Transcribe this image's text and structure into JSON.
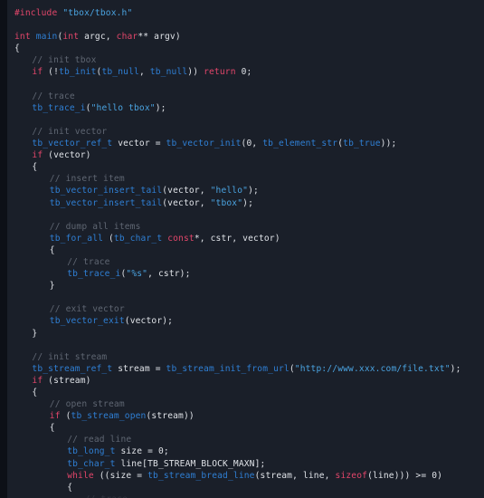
{
  "editor": {
    "language": "c",
    "theme_name": "dark",
    "background_color": "#1a1f29",
    "gutter_color": "#0d1017",
    "colors": {
      "keyword": "#e2466a",
      "preprocessor": "#e2466a",
      "function": "#2f7fd4",
      "type": "#2f7fd4",
      "string": "#4aa3e0",
      "comment": "#5f6672",
      "number": "#dfe2e7",
      "plain": "#dfe2e7"
    },
    "font_size_px": 9.6,
    "line_height_px": 13.1,
    "indent_spaces": 4
  },
  "code": {
    "header_include": "#include \"tbox/tbox.h\"",
    "header_include_directive": "#include",
    "header_include_path": "\"tbox/tbox.h\"",
    "lines": [
      {
        "indent": 0,
        "tokens": [
          {
            "c": "t-pre",
            "t": "#include"
          },
          {
            "c": "t-plain",
            "t": " "
          },
          {
            "c": "t-str",
            "t": "\"tbox/tbox.h\""
          }
        ]
      },
      {
        "indent": 0,
        "tokens": []
      },
      {
        "indent": 0,
        "tokens": [
          {
            "c": "t-kw",
            "t": "int"
          },
          {
            "c": "t-plain",
            "t": " "
          },
          {
            "c": "t-fn",
            "t": "main"
          },
          {
            "c": "t-plain",
            "t": "("
          },
          {
            "c": "t-kw",
            "t": "int"
          },
          {
            "c": "t-plain",
            "t": " argc, "
          },
          {
            "c": "t-kw",
            "t": "char"
          },
          {
            "c": "t-plain",
            "t": "** argv)"
          }
        ]
      },
      {
        "indent": 0,
        "tokens": [
          {
            "c": "t-plain",
            "t": "{"
          }
        ]
      },
      {
        "indent": 1,
        "tokens": [
          {
            "c": "t-cmt",
            "t": "// init tbox"
          }
        ]
      },
      {
        "indent": 1,
        "tokens": [
          {
            "c": "t-kw",
            "t": "if"
          },
          {
            "c": "t-plain",
            "t": " (!"
          },
          {
            "c": "t-fn",
            "t": "tb_init"
          },
          {
            "c": "t-plain",
            "t": "("
          },
          {
            "c": "t-fn",
            "t": "tb_null"
          },
          {
            "c": "t-plain",
            "t": ", "
          },
          {
            "c": "t-fn",
            "t": "tb_null"
          },
          {
            "c": "t-plain",
            "t": ")) "
          },
          {
            "c": "t-kw",
            "t": "return"
          },
          {
            "c": "t-plain",
            "t": " "
          },
          {
            "c": "t-num",
            "t": "0"
          },
          {
            "c": "t-plain",
            "t": ";"
          }
        ]
      },
      {
        "indent": 0,
        "tokens": []
      },
      {
        "indent": 1,
        "tokens": [
          {
            "c": "t-cmt",
            "t": "// trace"
          }
        ]
      },
      {
        "indent": 1,
        "tokens": [
          {
            "c": "t-fn",
            "t": "tb_trace_i"
          },
          {
            "c": "t-plain",
            "t": "("
          },
          {
            "c": "t-str",
            "t": "\"hello tbox\""
          },
          {
            "c": "t-plain",
            "t": ");"
          }
        ]
      },
      {
        "indent": 0,
        "tokens": []
      },
      {
        "indent": 1,
        "tokens": [
          {
            "c": "t-cmt",
            "t": "// init vector"
          }
        ]
      },
      {
        "indent": 1,
        "tokens": [
          {
            "c": "t-type",
            "t": "tb_vector_ref_t"
          },
          {
            "c": "t-plain",
            "t": " vector = "
          },
          {
            "c": "t-fn",
            "t": "tb_vector_init"
          },
          {
            "c": "t-plain",
            "t": "("
          },
          {
            "c": "t-num",
            "t": "0"
          },
          {
            "c": "t-plain",
            "t": ", "
          },
          {
            "c": "t-fn",
            "t": "tb_element_str"
          },
          {
            "c": "t-plain",
            "t": "("
          },
          {
            "c": "t-fn",
            "t": "tb_true"
          },
          {
            "c": "t-plain",
            "t": "));"
          }
        ]
      },
      {
        "indent": 1,
        "tokens": [
          {
            "c": "t-kw",
            "t": "if"
          },
          {
            "c": "t-plain",
            "t": " (vector)"
          }
        ]
      },
      {
        "indent": 1,
        "tokens": [
          {
            "c": "t-plain",
            "t": "{"
          }
        ]
      },
      {
        "indent": 2,
        "tokens": [
          {
            "c": "t-cmt",
            "t": "// insert item"
          }
        ]
      },
      {
        "indent": 2,
        "tokens": [
          {
            "c": "t-fn",
            "t": "tb_vector_insert_tail"
          },
          {
            "c": "t-plain",
            "t": "(vector, "
          },
          {
            "c": "t-str",
            "t": "\"hello\""
          },
          {
            "c": "t-plain",
            "t": ");"
          }
        ]
      },
      {
        "indent": 2,
        "tokens": [
          {
            "c": "t-fn",
            "t": "tb_vector_insert_tail"
          },
          {
            "c": "t-plain",
            "t": "(vector, "
          },
          {
            "c": "t-str",
            "t": "\"tbox\""
          },
          {
            "c": "t-plain",
            "t": ");"
          }
        ]
      },
      {
        "indent": 0,
        "tokens": []
      },
      {
        "indent": 2,
        "tokens": [
          {
            "c": "t-cmt",
            "t": "// dump all items"
          }
        ]
      },
      {
        "indent": 2,
        "tokens": [
          {
            "c": "t-fn",
            "t": "tb_for_all"
          },
          {
            "c": "t-plain",
            "t": " ("
          },
          {
            "c": "t-type",
            "t": "tb_char_t"
          },
          {
            "c": "t-plain",
            "t": " "
          },
          {
            "c": "t-kw",
            "t": "const"
          },
          {
            "c": "t-plain",
            "t": "*, cstr, vector)"
          }
        ]
      },
      {
        "indent": 2,
        "tokens": [
          {
            "c": "t-plain",
            "t": "{"
          }
        ]
      },
      {
        "indent": 3,
        "tokens": [
          {
            "c": "t-cmt",
            "t": "// trace"
          }
        ]
      },
      {
        "indent": 3,
        "tokens": [
          {
            "c": "t-fn",
            "t": "tb_trace_i"
          },
          {
            "c": "t-plain",
            "t": "("
          },
          {
            "c": "t-str",
            "t": "\"%s\""
          },
          {
            "c": "t-plain",
            "t": ", cstr);"
          }
        ]
      },
      {
        "indent": 2,
        "tokens": [
          {
            "c": "t-plain",
            "t": "}"
          }
        ]
      },
      {
        "indent": 0,
        "tokens": []
      },
      {
        "indent": 2,
        "tokens": [
          {
            "c": "t-cmt",
            "t": "// exit vector"
          }
        ]
      },
      {
        "indent": 2,
        "tokens": [
          {
            "c": "t-fn",
            "t": "tb_vector_exit"
          },
          {
            "c": "t-plain",
            "t": "(vector);"
          }
        ]
      },
      {
        "indent": 1,
        "tokens": [
          {
            "c": "t-plain",
            "t": "}"
          }
        ]
      },
      {
        "indent": 0,
        "tokens": []
      },
      {
        "indent": 1,
        "tokens": [
          {
            "c": "t-cmt",
            "t": "// init stream"
          }
        ]
      },
      {
        "indent": 1,
        "tokens": [
          {
            "c": "t-type",
            "t": "tb_stream_ref_t"
          },
          {
            "c": "t-plain",
            "t": " stream = "
          },
          {
            "c": "t-fn",
            "t": "tb_stream_init_from_url"
          },
          {
            "c": "t-plain",
            "t": "("
          },
          {
            "c": "t-str",
            "t": "\"http://www.xxx.com/file.txt\""
          },
          {
            "c": "t-plain",
            "t": ");"
          }
        ]
      },
      {
        "indent": 1,
        "tokens": [
          {
            "c": "t-kw",
            "t": "if"
          },
          {
            "c": "t-plain",
            "t": " (stream)"
          }
        ]
      },
      {
        "indent": 1,
        "tokens": [
          {
            "c": "t-plain",
            "t": "{"
          }
        ]
      },
      {
        "indent": 2,
        "tokens": [
          {
            "c": "t-cmt",
            "t": "// open stream"
          }
        ]
      },
      {
        "indent": 2,
        "tokens": [
          {
            "c": "t-kw",
            "t": "if"
          },
          {
            "c": "t-plain",
            "t": " ("
          },
          {
            "c": "t-fn",
            "t": "tb_stream_open"
          },
          {
            "c": "t-plain",
            "t": "(stream))"
          }
        ]
      },
      {
        "indent": 2,
        "tokens": [
          {
            "c": "t-plain",
            "t": "{"
          }
        ]
      },
      {
        "indent": 3,
        "tokens": [
          {
            "c": "t-cmt",
            "t": "// read line"
          }
        ]
      },
      {
        "indent": 3,
        "tokens": [
          {
            "c": "t-type",
            "t": "tb_long_t"
          },
          {
            "c": "t-plain",
            "t": " size = "
          },
          {
            "c": "t-num",
            "t": "0"
          },
          {
            "c": "t-plain",
            "t": ";"
          }
        ]
      },
      {
        "indent": 3,
        "tokens": [
          {
            "c": "t-type",
            "t": "tb_char_t"
          },
          {
            "c": "t-plain",
            "t": " line["
          },
          {
            "c": "t-macro",
            "t": "TB_STREAM_BLOCK_MAXN"
          },
          {
            "c": "t-plain",
            "t": "];"
          }
        ]
      },
      {
        "indent": 3,
        "tokens": [
          {
            "c": "t-kw",
            "t": "while"
          },
          {
            "c": "t-plain",
            "t": " ((size = "
          },
          {
            "c": "t-fn",
            "t": "tb_stream_bread_line"
          },
          {
            "c": "t-plain",
            "t": "(stream, line, "
          },
          {
            "c": "t-kw",
            "t": "sizeof"
          },
          {
            "c": "t-plain",
            "t": "(line))) >= "
          },
          {
            "c": "t-num",
            "t": "0"
          },
          {
            "c": "t-plain",
            "t": ")"
          }
        ]
      },
      {
        "indent": 3,
        "tokens": [
          {
            "c": "t-plain",
            "t": "{"
          }
        ]
      },
      {
        "indent": 4,
        "clipped": true,
        "tokens": [
          {
            "c": "t-cmt",
            "t": "// trace"
          }
        ]
      }
    ]
  }
}
